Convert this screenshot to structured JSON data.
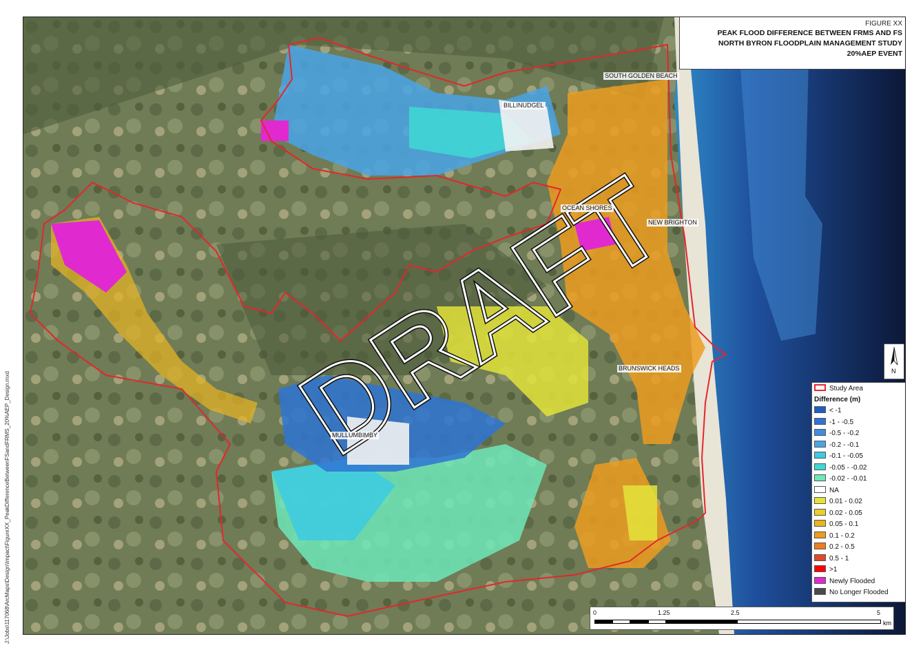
{
  "title": {
    "figure": "FIGURE XX",
    "line1": "PEAK FLOOD DIFFERENCE BETWEEN FRMS AND FS",
    "line2": "NORTH BYRON FLOODPLAIN MANAGEMENT STUDY",
    "line3": "20%AEP EVENT"
  },
  "places": {
    "south_golden_beach": "SOUTH GOLDEN BEACH",
    "billinudgel": "BILLINUDGEL",
    "ocean_shores": "OCEAN SHORES",
    "new_brighton": "NEW BRIGHTON",
    "brunswick_heads": "BRUNSWICK HEADS",
    "mullumbimby": "MULLUMBIMBY"
  },
  "watermark": "DRAFT",
  "file_path": "J:\\Jobs\\117068\\ArcMaps\\Design\\Impact\\FigureXX_PeakDifferenceBetweenFSandFRMS_20%AEP_Design.mxd",
  "legend": {
    "study_area_label": "Study Area",
    "study_area_color": "#e4262c",
    "heading": "Difference (m)",
    "classes": [
      {
        "label": "< -1",
        "color": "#1f5fbf"
      },
      {
        "label": "-1 - -0.5",
        "color": "#2f74d4"
      },
      {
        "label": "-0.5 - -0.2",
        "color": "#3f8ee3"
      },
      {
        "label": "-0.2 - -0.1",
        "color": "#4aa5e6"
      },
      {
        "label": "-0.1 - -0.05",
        "color": "#3ccbe3"
      },
      {
        "label": "-0.05 - -0.02",
        "color": "#3ed8d5"
      },
      {
        "label": "-0.02 - -0.01",
        "color": "#6ee8b8"
      },
      {
        "label": "NA",
        "color": "#ffffff"
      },
      {
        "label": "0.01 - 0.02",
        "color": "#e3e33a"
      },
      {
        "label": "0.02 - 0.05",
        "color": "#e8cf2a"
      },
      {
        "label": "0.05 - 0.1",
        "color": "#e9b522"
      },
      {
        "label": "0.1 - 0.2",
        "color": "#ec9c20"
      },
      {
        "label": "0.2 - 0.5",
        "color": "#ec7e1e"
      },
      {
        "label": "0.5 - 1",
        "color": "#e04a2a"
      },
      {
        "label": ">1",
        "color": "#ff0000"
      },
      {
        "label": "Newly Flooded",
        "color": "#e02ad0"
      },
      {
        "label": "No Longer Flooded",
        "color": "#4a4a4a"
      }
    ]
  },
  "north_arrow": "N",
  "scale": {
    "ticks": [
      "0",
      "1.25",
      "2.5",
      "5"
    ],
    "unit": "km"
  }
}
